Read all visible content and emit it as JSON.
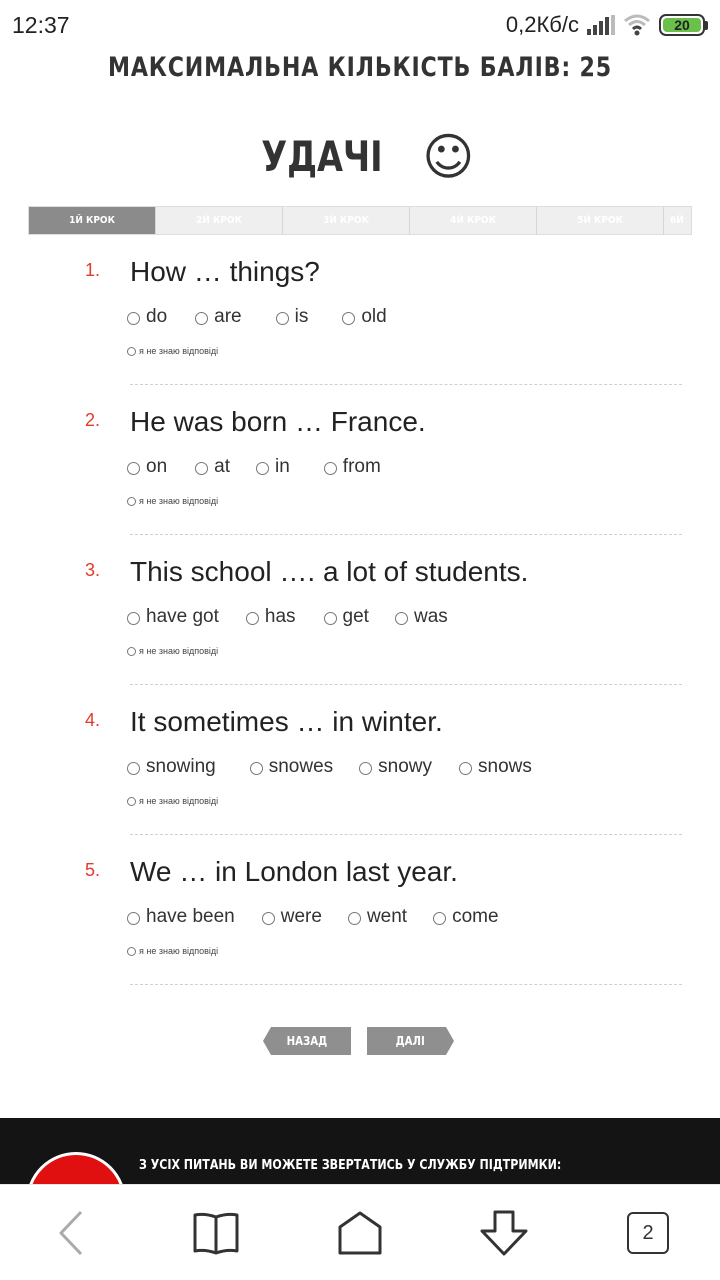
{
  "status_bar": {
    "time": "12:37",
    "speed": "0,2Кб/с",
    "battery": "20",
    "battery_color": "#6ac04a"
  },
  "header": {
    "max_score": "МАКСИМАЛЬНА КІЛЬКІСТЬ БАЛІВ: 25",
    "good_luck": "УДАЧІ",
    "smile": "☺"
  },
  "steps": [
    {
      "label": "1й крок",
      "active": true
    },
    {
      "label": "2й крок",
      "active": false
    },
    {
      "label": "3й крок",
      "active": false
    },
    {
      "label": "4й крок",
      "active": false
    },
    {
      "label": "5й крок",
      "active": false
    },
    {
      "label": "6й",
      "active": false
    }
  ],
  "dont_know_label": "я не знаю відповіді",
  "questions": [
    {
      "number": "1.",
      "text": "How … things?",
      "options": [
        "do",
        "are",
        "is",
        "old"
      ]
    },
    {
      "number": "2.",
      "text": "He was born … France.",
      "options": [
        "on",
        "at",
        "in",
        "from"
      ]
    },
    {
      "number": "3.",
      "text": "This school …. a lot of students.",
      "options": [
        "have got",
        "has",
        "get",
        "was"
      ]
    },
    {
      "number": "4.",
      "text": "It sometimes … in winter.",
      "options": [
        "snowing",
        "snowes",
        "snowy",
        "snows"
      ]
    },
    {
      "number": "5.",
      "text": "We … in London last year.",
      "options": [
        "have been",
        "were",
        "went",
        "come"
      ]
    }
  ],
  "nav": {
    "back": "НАЗАД",
    "next": "ДАЛІ"
  },
  "footer": {
    "support_text": "З УСІХ ПИТАНЬ ВИ МОЖЕТЕ ЗВЕРТАТИСЬ У СЛУЖБУ ПІДТРИМКИ:"
  },
  "bottom_bar": {
    "icons": [
      "back-arrow-icon",
      "bookmarks-book-icon",
      "home-icon",
      "download-icon"
    ],
    "tabs_count": "2"
  },
  "colors": {
    "accent_red": "#e33a2b",
    "step_active": "#8b8b8b",
    "button_gray": "#8f8f8f"
  }
}
